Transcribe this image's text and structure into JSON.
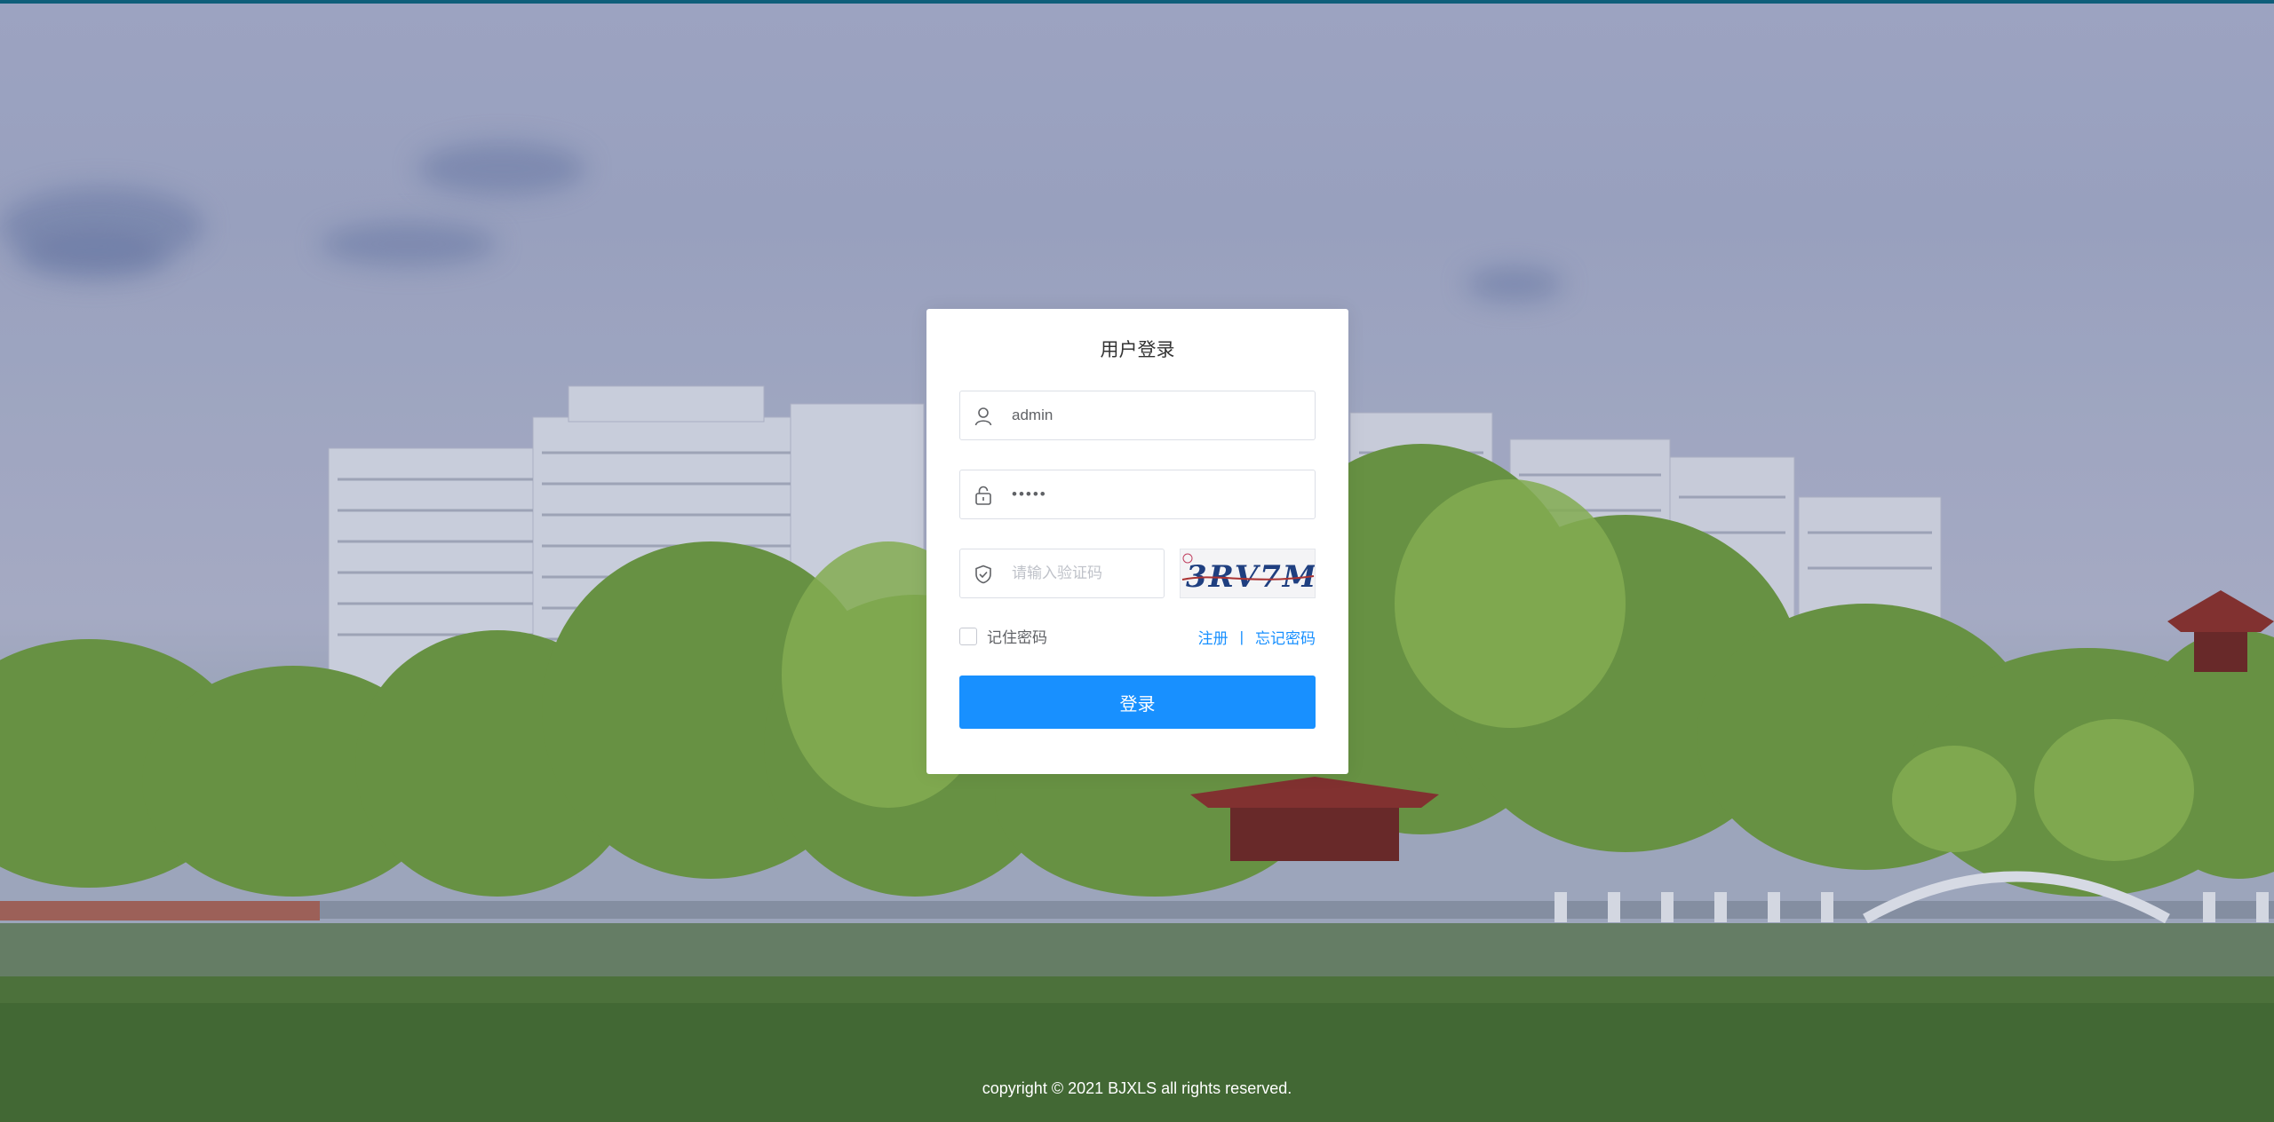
{
  "login": {
    "title": "用户登录",
    "username": {
      "value": "admin",
      "icon": "user-icon"
    },
    "password": {
      "value": "•••••",
      "icon": "lock-icon"
    },
    "captcha_input": {
      "placeholder": "请输入验证码",
      "icon": "shield-icon"
    },
    "captcha_image": {
      "text": "3RV7M"
    },
    "remember_label": "记住密码",
    "register_link": "注册",
    "separator": "|",
    "forgot_link": "忘记密码",
    "submit_label": "登录"
  },
  "footer": {
    "copyright": "copyright © 2021 BJXLS all rights reserved."
  },
  "colors": {
    "primary": "#1890ff",
    "top_strip": "#0f5e7a",
    "card_bg": "#ffffff"
  }
}
